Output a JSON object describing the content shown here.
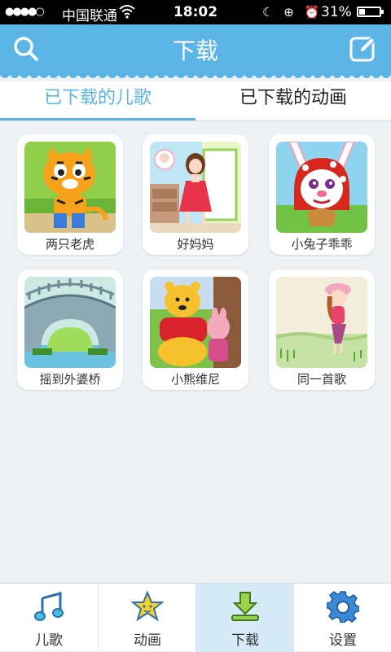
{
  "status_bar": {
    "signal": "●●●●○",
    "carrier": "中国联通",
    "wifi_icon": "wifi-icon",
    "time": "18:02",
    "status_icons": "☾ ⊕ ⏰",
    "battery_text": "31%",
    "battery_level": 0.31
  },
  "header": {
    "title": "下载",
    "left_icon": "search-icon",
    "right_icon": "edit-icon",
    "color": "#5ab5e6"
  },
  "tabs": [
    {
      "label": "已下载的儿歌",
      "active": true
    },
    {
      "label": "已下载的动画",
      "active": false
    }
  ],
  "songs": [
    {
      "title": "两只老虎"
    },
    {
      "title": "好妈妈"
    },
    {
      "title": "小兔子乖乖"
    },
    {
      "title": "摇到外婆桥"
    },
    {
      "title": "小熊维尼"
    },
    {
      "title": "同一首歌"
    }
  ],
  "bottom_nav": [
    {
      "label": "儿歌",
      "icon": "music-note-icon",
      "active": false
    },
    {
      "label": "动画",
      "icon": "star-icon",
      "active": false
    },
    {
      "label": "下载",
      "icon": "download-icon",
      "active": true
    },
    {
      "label": "设置",
      "icon": "gear-icon",
      "active": false
    }
  ]
}
